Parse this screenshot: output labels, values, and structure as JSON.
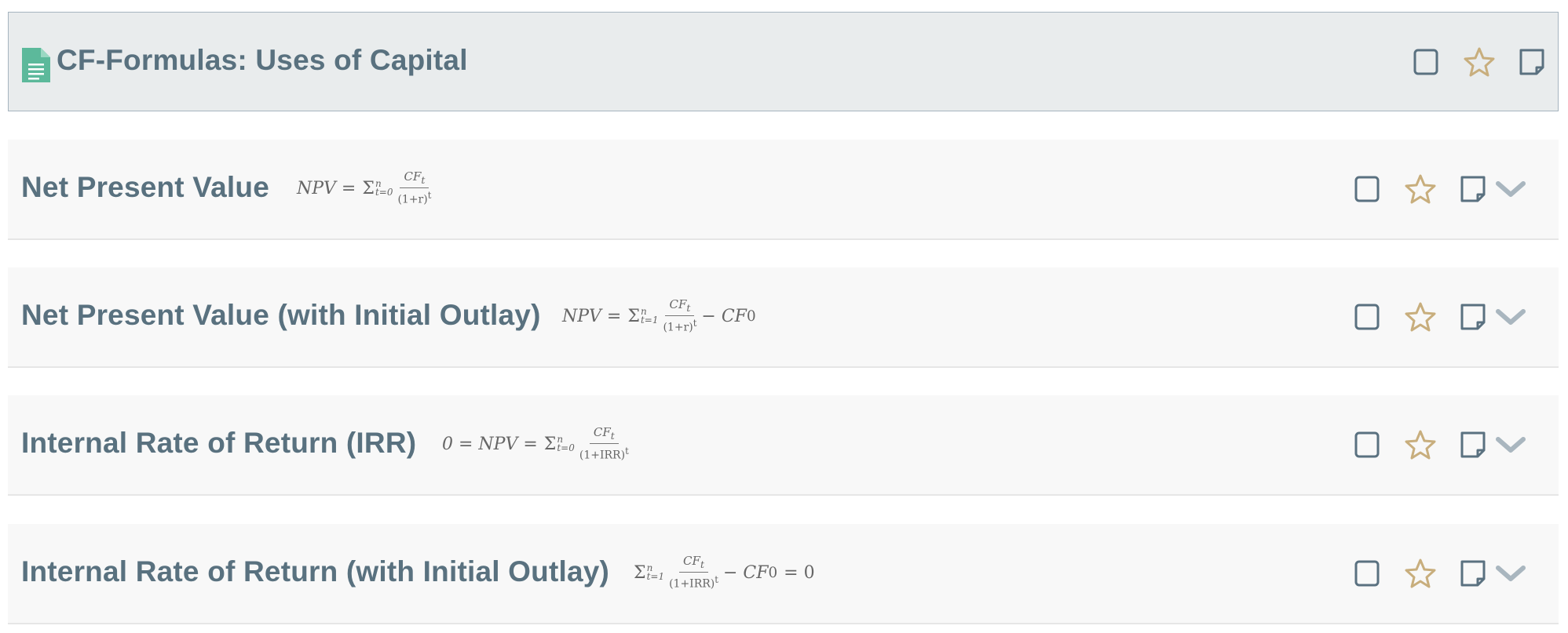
{
  "deck": {
    "title": "CF-Formulas: Uses of Capital",
    "icon": "document-icon",
    "icon_color": "#5cb99b"
  },
  "cards": [
    {
      "title": "Net Present Value",
      "formula": {
        "lhs": "NPV =",
        "sigma": "Σ",
        "upper": "n",
        "lower": "t=0",
        "numerator": "CF",
        "numerator_sub": "t",
        "denominator": "(1+r)",
        "denominator_sup": "t",
        "tail": ""
      }
    },
    {
      "title": "Net Present Value (with Initial Outlay)",
      "formula": {
        "lhs": "NPV =",
        "sigma": "Σ",
        "upper": "n",
        "lower": "t=1",
        "numerator": "CF",
        "numerator_sub": "t",
        "denominator": "(1+r)",
        "denominator_sup": "t",
        "tail": "− CF",
        "tail_sub": "0"
      }
    },
    {
      "title": "Internal Rate of Return (IRR)",
      "formula": {
        "lhs": "0 = NPV =",
        "sigma": "Σ",
        "upper": "n",
        "lower": "t=0",
        "numerator": "CF",
        "numerator_sub": "t",
        "denominator": "(1+IRR)",
        "denominator_sup": "t",
        "tail": ""
      }
    },
    {
      "title": "Internal Rate of Return (with Initial Outlay)",
      "formula": {
        "lhs": "",
        "sigma": "Σ",
        "upper": "n",
        "lower": "t=1",
        "numerator": "CF",
        "numerator_sub": "t",
        "denominator": "(1+IRR)",
        "denominator_sup": "t",
        "tail": "− CF",
        "tail_sub": "0",
        "tail2": "= 0"
      }
    }
  ],
  "icons": {
    "checkbox": "checkbox-icon",
    "star": "star-icon",
    "note": "note-icon",
    "expand": "chevron-down-icon"
  },
  "colors": {
    "title": "#59717f",
    "icon_outline": "#5a7180",
    "star": "#c8ae7d",
    "chevron": "#a9b6bf",
    "header_bg": "#e9eced",
    "card_bg": "#f8f8f8"
  }
}
